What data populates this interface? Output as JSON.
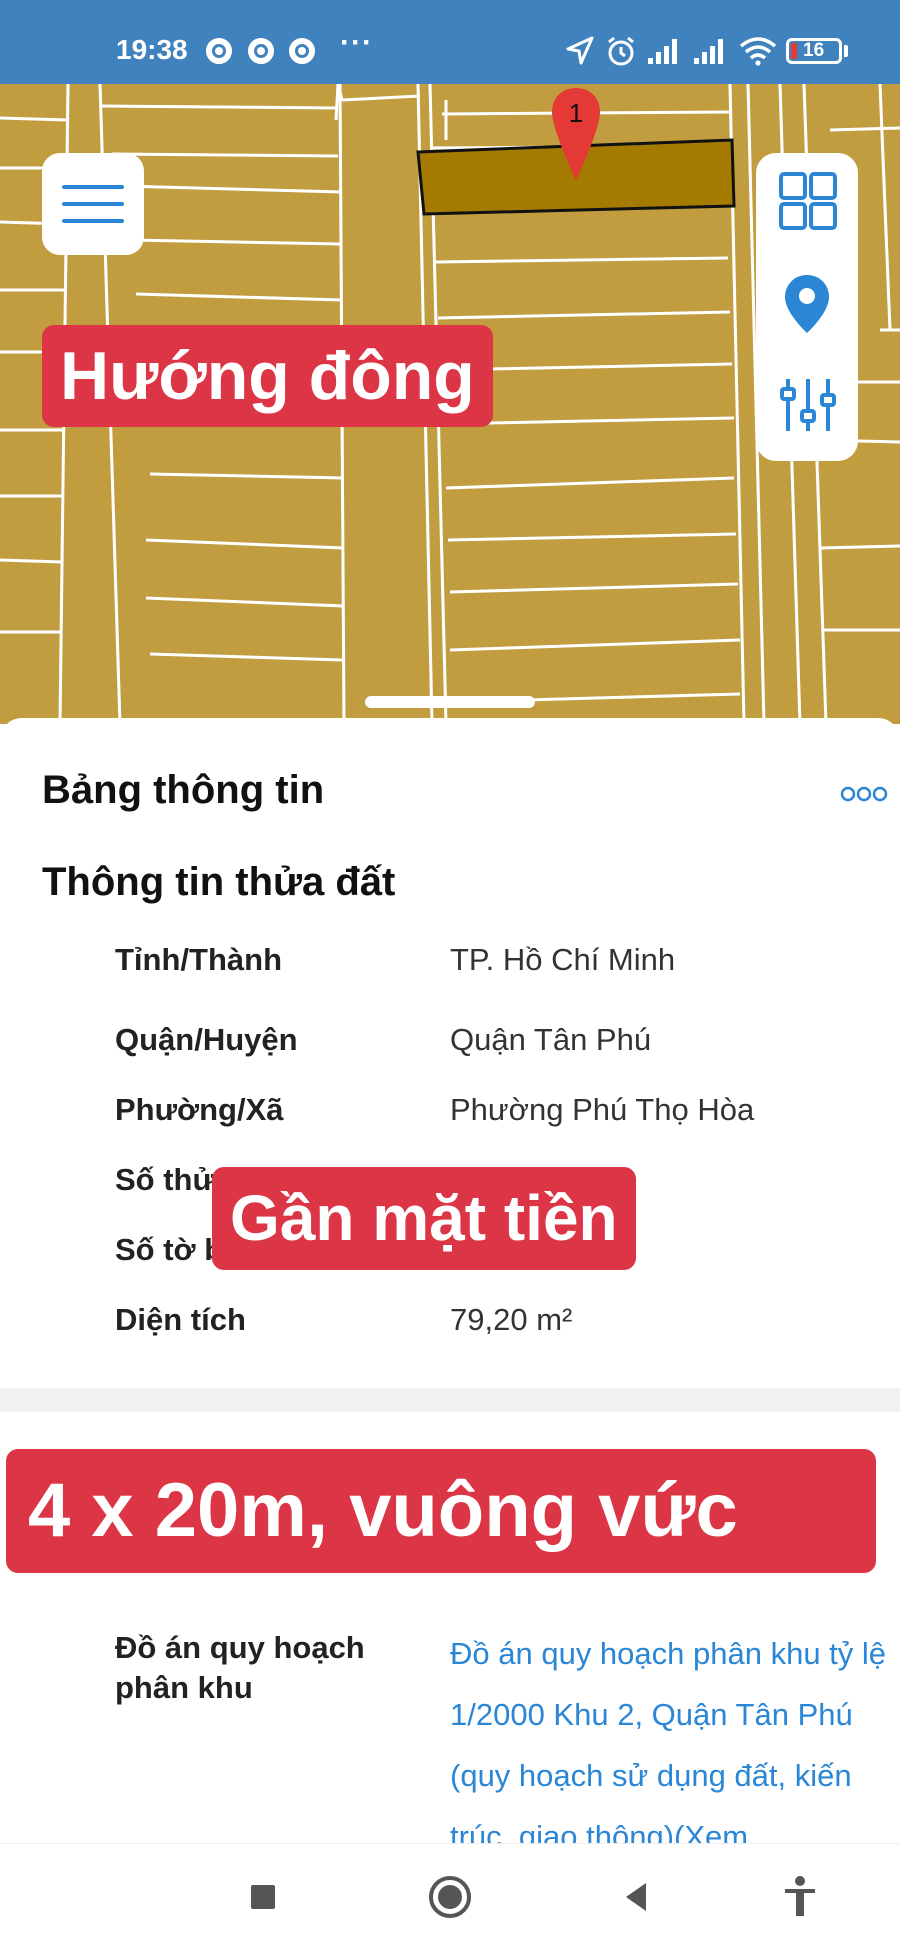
{
  "status_bar": {
    "time": "19:38",
    "more": "···",
    "battery": "16"
  },
  "map": {
    "parcel_marker": "1",
    "parcel_color": "#a47a00",
    "land_color": "#c19d40"
  },
  "overlays": {
    "direction": "Hướng đông",
    "frontage": "Gần mặt tiền",
    "size": "4 x 20m, vuông vức"
  },
  "sheet": {
    "title": "Bảng thông tin",
    "section_title": "Thông tin thửa đất",
    "rows": [
      {
        "label": "Tỉnh/Thành",
        "value": "TP. Hồ Chí Minh"
      },
      {
        "label": "Quận/Huyện",
        "value": "Quận Tân Phú"
      },
      {
        "label": "Phường/Xã",
        "value": "Phường Phú Thọ Hòa"
      },
      {
        "label": "Số thử",
        "value": ""
      },
      {
        "label": "Số tờ b",
        "value": ""
      },
      {
        "label": "Diện tích",
        "value": "79,20 m²"
      }
    ],
    "plan_label": "Đồ án quy hoạch phân khu",
    "plan_value": "Đồ án quy hoạch phân khu tỷ lệ 1/2000 Khu 2, Quận Tân Phú (quy hoạch sử dụng đất, kiến trúc, giao thông)(Xem"
  },
  "colors": {
    "accent": "#2b86d6",
    "label_red": "#dc3545",
    "status_bar": "#3f82bd"
  }
}
